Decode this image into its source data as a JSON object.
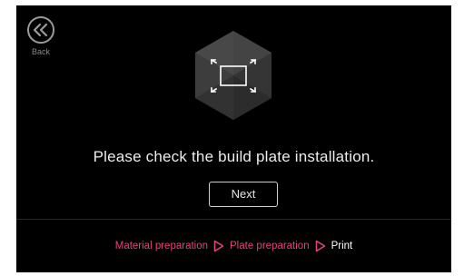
{
  "colors": {
    "background": "#000000",
    "accent": "#e0457b",
    "hexagon": "#3a3a3a",
    "text": "#ececec"
  },
  "back": {
    "label": "Back",
    "icon": "double-chevron-left-icon"
  },
  "illustration": {
    "icon": "build-plate-expand-icon"
  },
  "message": "Please check the build plate installation.",
  "next_label": "Next",
  "steps": [
    {
      "label": "Material preparation",
      "state": "done"
    },
    {
      "label": "Plate preparation",
      "state": "done"
    },
    {
      "label": "Print",
      "state": "current"
    }
  ]
}
